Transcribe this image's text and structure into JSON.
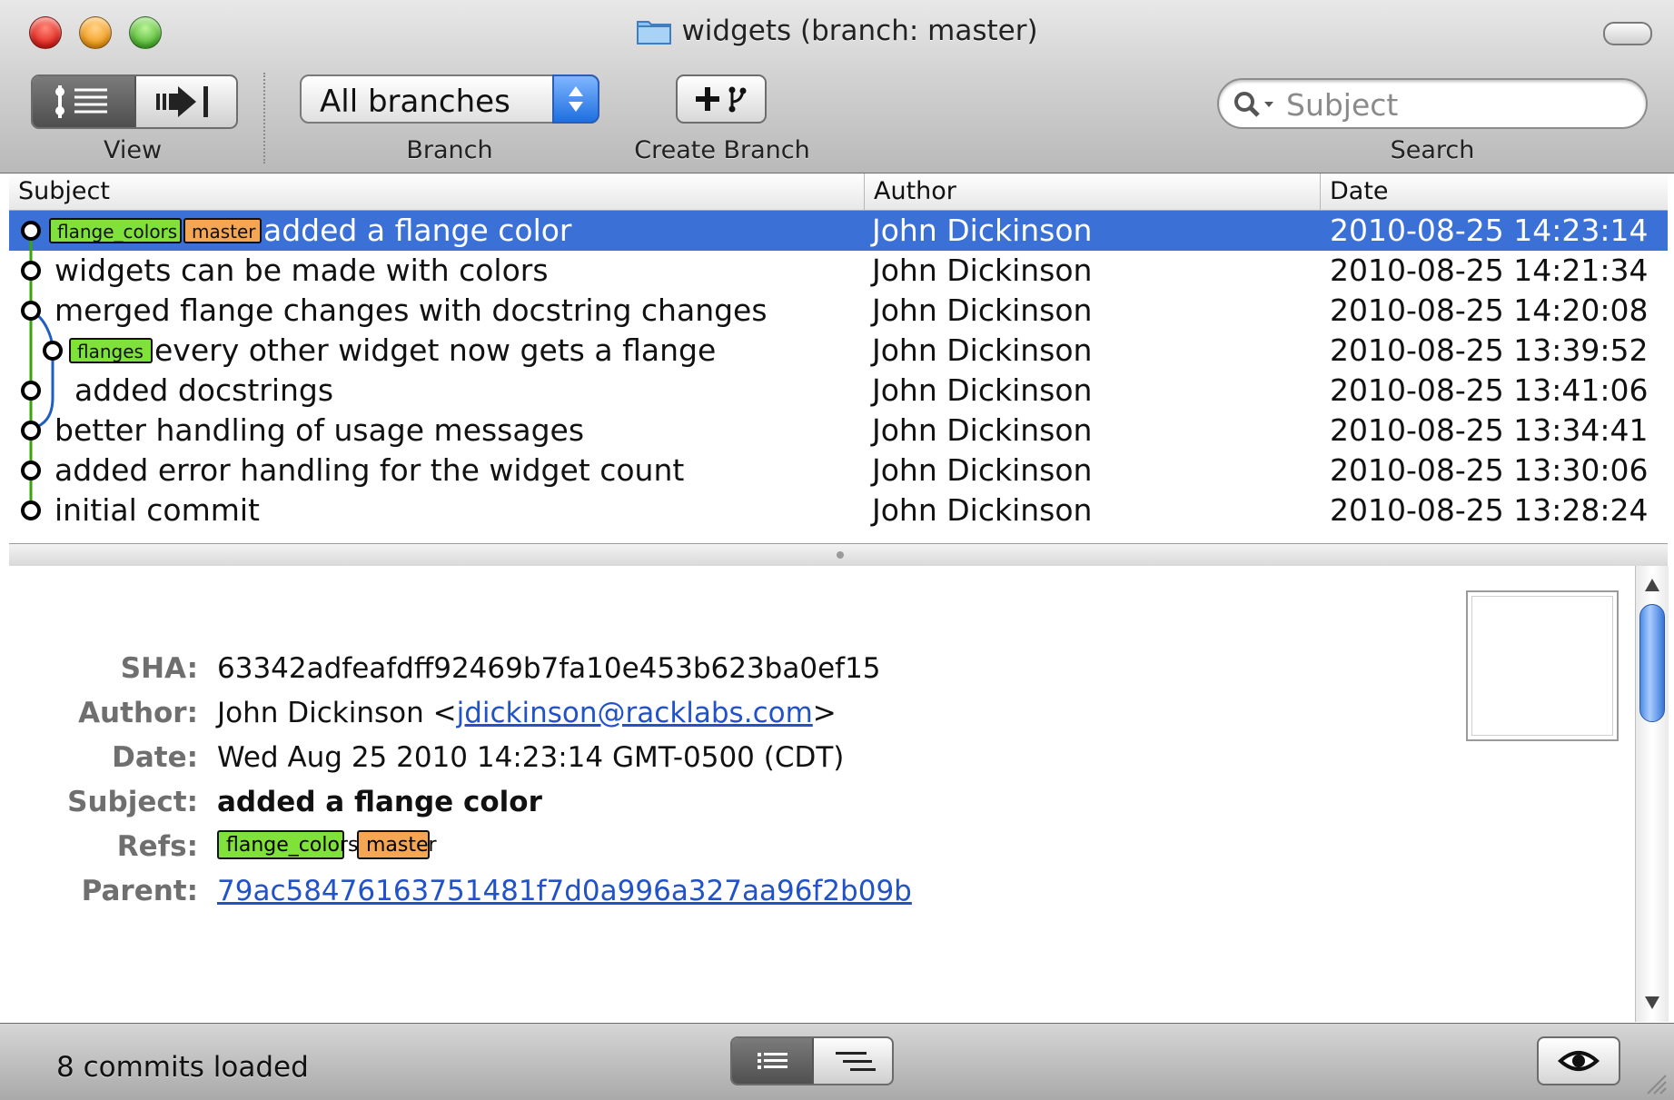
{
  "window": {
    "title": "widgets (branch: master)"
  },
  "toolbar": {
    "view_label": "View",
    "branch_label": "Branch",
    "branch_value": "All branches",
    "create_branch_label": "Create Branch",
    "search_label": "Search",
    "search_placeholder": "Subject"
  },
  "list": {
    "columns": {
      "subject": "Subject",
      "author": "Author",
      "date": "Date"
    },
    "rows": [
      {
        "refs": [
          {
            "name": "flange_colors",
            "color": "#7fe13a"
          },
          {
            "name": "master",
            "color": "#f5a653"
          }
        ],
        "subject": "added a flange color",
        "author": "John Dickinson",
        "date": "2010-08-25 14:23:14",
        "selected": true
      },
      {
        "refs": [],
        "subject": "widgets can be made with colors",
        "author": "John Dickinson",
        "date": "2010-08-25 14:21:34"
      },
      {
        "refs": [],
        "subject": "merged flange changes with docstring changes",
        "author": "John Dickinson",
        "date": "2010-08-25 14:20:08"
      },
      {
        "refs": [
          {
            "name": "flanges",
            "color": "#7fe13a"
          }
        ],
        "subject": "every other widget now gets a flange",
        "author": "John Dickinson",
        "date": "2010-08-25 13:39:52"
      },
      {
        "refs": [],
        "subject": "added docstrings",
        "author": "John Dickinson",
        "date": "2010-08-25 13:41:06"
      },
      {
        "refs": [],
        "subject": "better handling of usage messages",
        "author": "John Dickinson",
        "date": "2010-08-25 13:34:41"
      },
      {
        "refs": [],
        "subject": "added error handling for the widget count",
        "author": "John Dickinson",
        "date": "2010-08-25 13:30:06"
      },
      {
        "refs": [],
        "subject": "initial commit",
        "author": "John Dickinson",
        "date": "2010-08-25 13:28:24"
      }
    ]
  },
  "detail": {
    "sha_label": "SHA:",
    "sha": "63342adfeafdff92469b7fa10e453b623ba0ef15",
    "author_label": "Author:",
    "author_name": "John Dickinson",
    "author_open": "<",
    "author_email": "jdickinson@racklabs.com",
    "author_close": ">",
    "date_label": "Date:",
    "date": "Wed Aug 25 2010 14:23:14 GMT-0500 (CDT)",
    "subject_label": "Subject:",
    "subject": "added a flange color",
    "refs_label": "Refs:",
    "refs": [
      {
        "name": "flange_colors",
        "color": "#7fe13a"
      },
      {
        "name": "master",
        "color": "#f5a653"
      }
    ],
    "parent_label": "Parent:",
    "parent": "79ac58476163751481f7d0a996a327aa96f2b09b"
  },
  "status": {
    "text": "8 commits loaded"
  },
  "colors": {
    "selection": "#3b71d7",
    "graph_main": "#3aa40c",
    "graph_branch": "#1f5fbf",
    "link": "#2252c8"
  }
}
